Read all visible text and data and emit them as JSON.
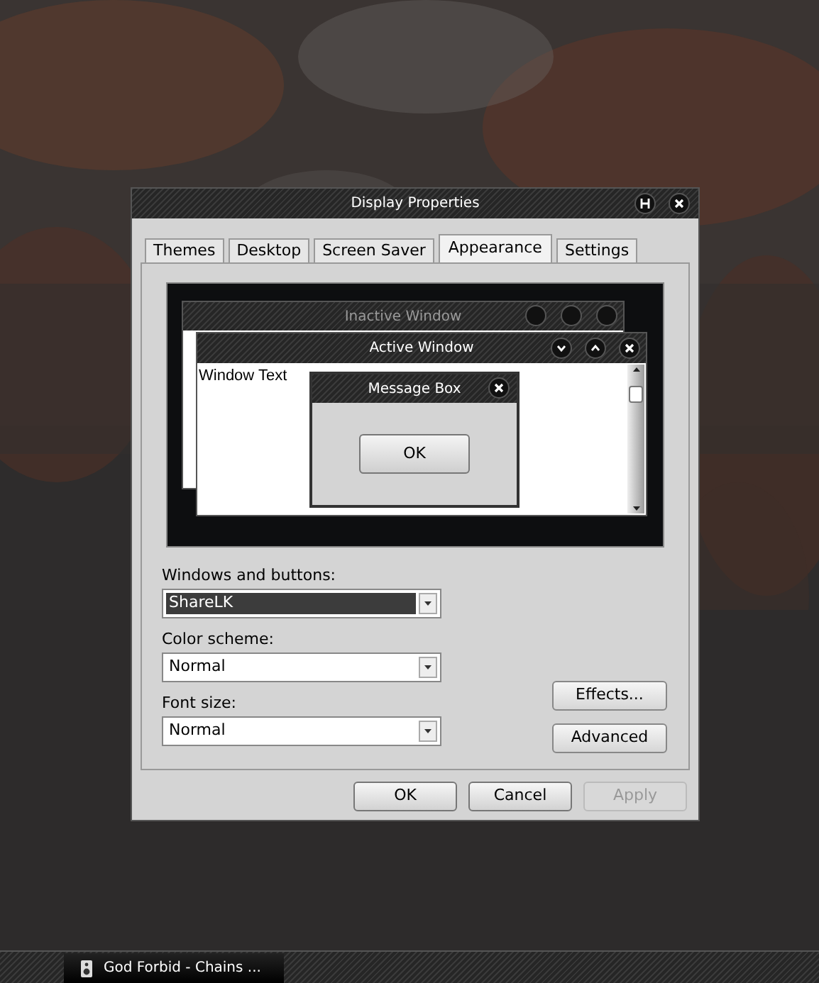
{
  "window": {
    "title": "Display Properties"
  },
  "tabs": [
    {
      "label": "Themes",
      "selected": false
    },
    {
      "label": "Desktop",
      "selected": false
    },
    {
      "label": "Screen Saver",
      "selected": false
    },
    {
      "label": "Appearance",
      "selected": true
    },
    {
      "label": "Settings",
      "selected": false
    }
  ],
  "preview": {
    "inactive_window": {
      "title": "Inactive Window"
    },
    "active_window": {
      "title": "Active Window",
      "text": "Window Text"
    },
    "message_box": {
      "title": "Message Box",
      "button": "OK"
    }
  },
  "fields": [
    {
      "label": "Windows and buttons:",
      "value": "ShareLK",
      "focused": true
    },
    {
      "label": "Color scheme:",
      "value": "Normal",
      "focused": false
    },
    {
      "label": "Font size:",
      "value": "Normal",
      "focused": false
    }
  ],
  "side_buttons": [
    "Effects...",
    "Advanced"
  ],
  "buttons": [
    {
      "label": "OK",
      "disabled": false
    },
    {
      "label": "Cancel",
      "disabled": false
    },
    {
      "label": "Apply",
      "disabled": true
    }
  ],
  "taskbar": {
    "tasks": [
      {
        "label": "God Forbid - Chains ..."
      }
    ]
  }
}
